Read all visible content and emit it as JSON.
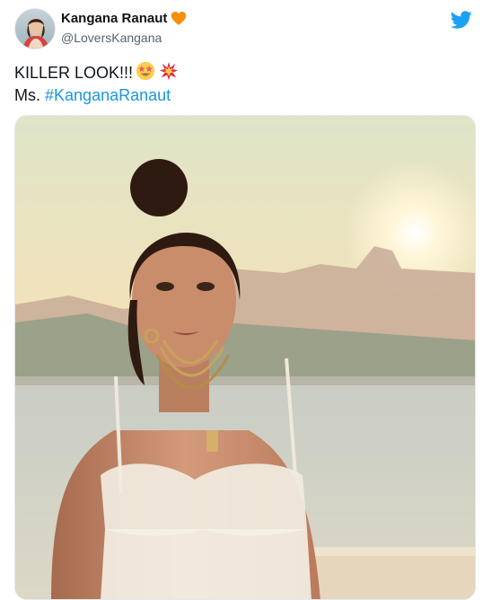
{
  "tweet": {
    "author_name": "Kangana Ranaut",
    "author_handle": "@LoversKangana",
    "text_line1": "KILLER LOOK!!!",
    "text_line2_prefix": "Ms.",
    "hashtag": "#KanganaRanaut"
  },
  "icons": {
    "verified_heart": "orange-heart-icon",
    "brand": "twitter-bird-icon",
    "emoji1": "star-struck-emoji-icon",
    "emoji2": "collision-emoji-icon"
  },
  "colors": {
    "link": "#1b95e0",
    "brand": "#1da1f2",
    "heart": "#f4900c",
    "handle": "#536471"
  }
}
